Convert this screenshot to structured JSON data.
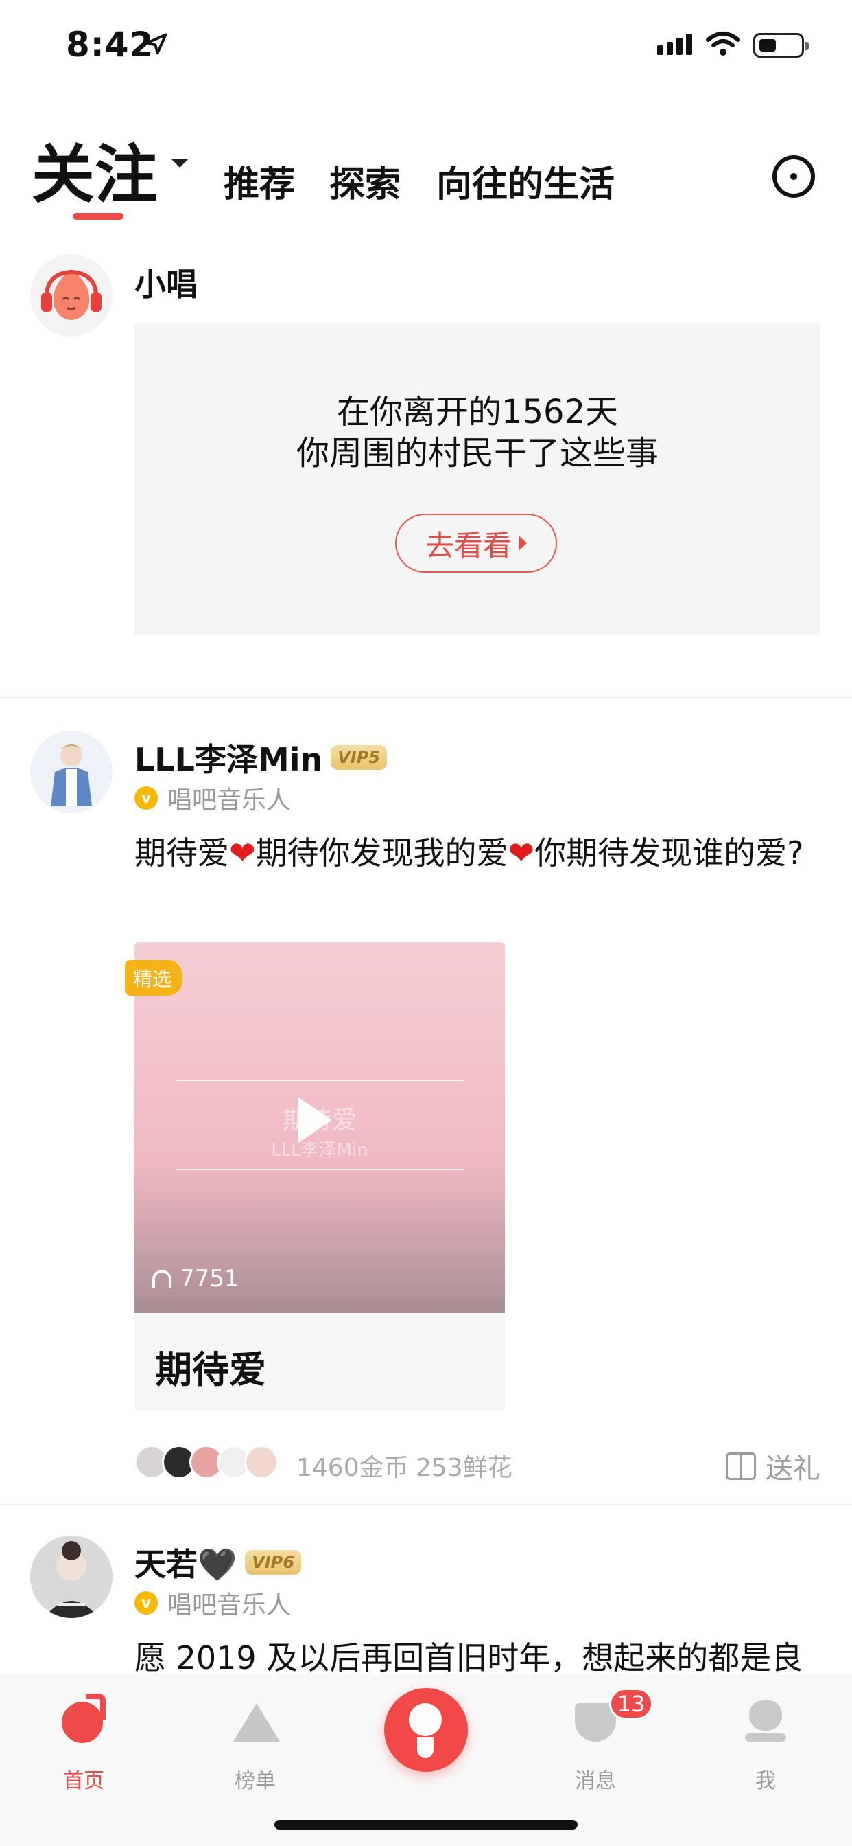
{
  "status_bar": {
    "time": "8:42"
  },
  "top_tabs": {
    "active": "关注",
    "items": [
      "推荐",
      "探索",
      "向往的生活"
    ]
  },
  "post1": {
    "username": "小唱",
    "card_line1": "在你离开的1562天",
    "card_line2": "你周围的村民干了这些事",
    "button": "去看看"
  },
  "post2": {
    "username": "LLL李泽Min",
    "vip": "VIP5",
    "role": "唱吧音乐人",
    "text_a": "期待爱",
    "text_b": "期待你发现我的爱",
    "text_c": "你期待发现谁的爱?",
    "badge": "精选",
    "media_title": "期待爱",
    "media_sub": "LLL李泽Min",
    "plays": "7751",
    "song_title": "期待爱",
    "coins": "1460金币",
    "flowers": "253鲜花",
    "gift": "送礼"
  },
  "post3": {
    "username": "天若🖤",
    "vip": "VIP6",
    "role": "唱吧音乐人",
    "text": "愿 2019 及以后再回首旧时年，想起来的都是良"
  },
  "bottom_nav": {
    "home": "首页",
    "rank": "榜单",
    "messages": "消息",
    "messages_badge": "13",
    "me": "我"
  },
  "colors": {
    "accent": "#ef4a4a",
    "gold": "#f5b317",
    "muted": "#9a9a9a"
  }
}
